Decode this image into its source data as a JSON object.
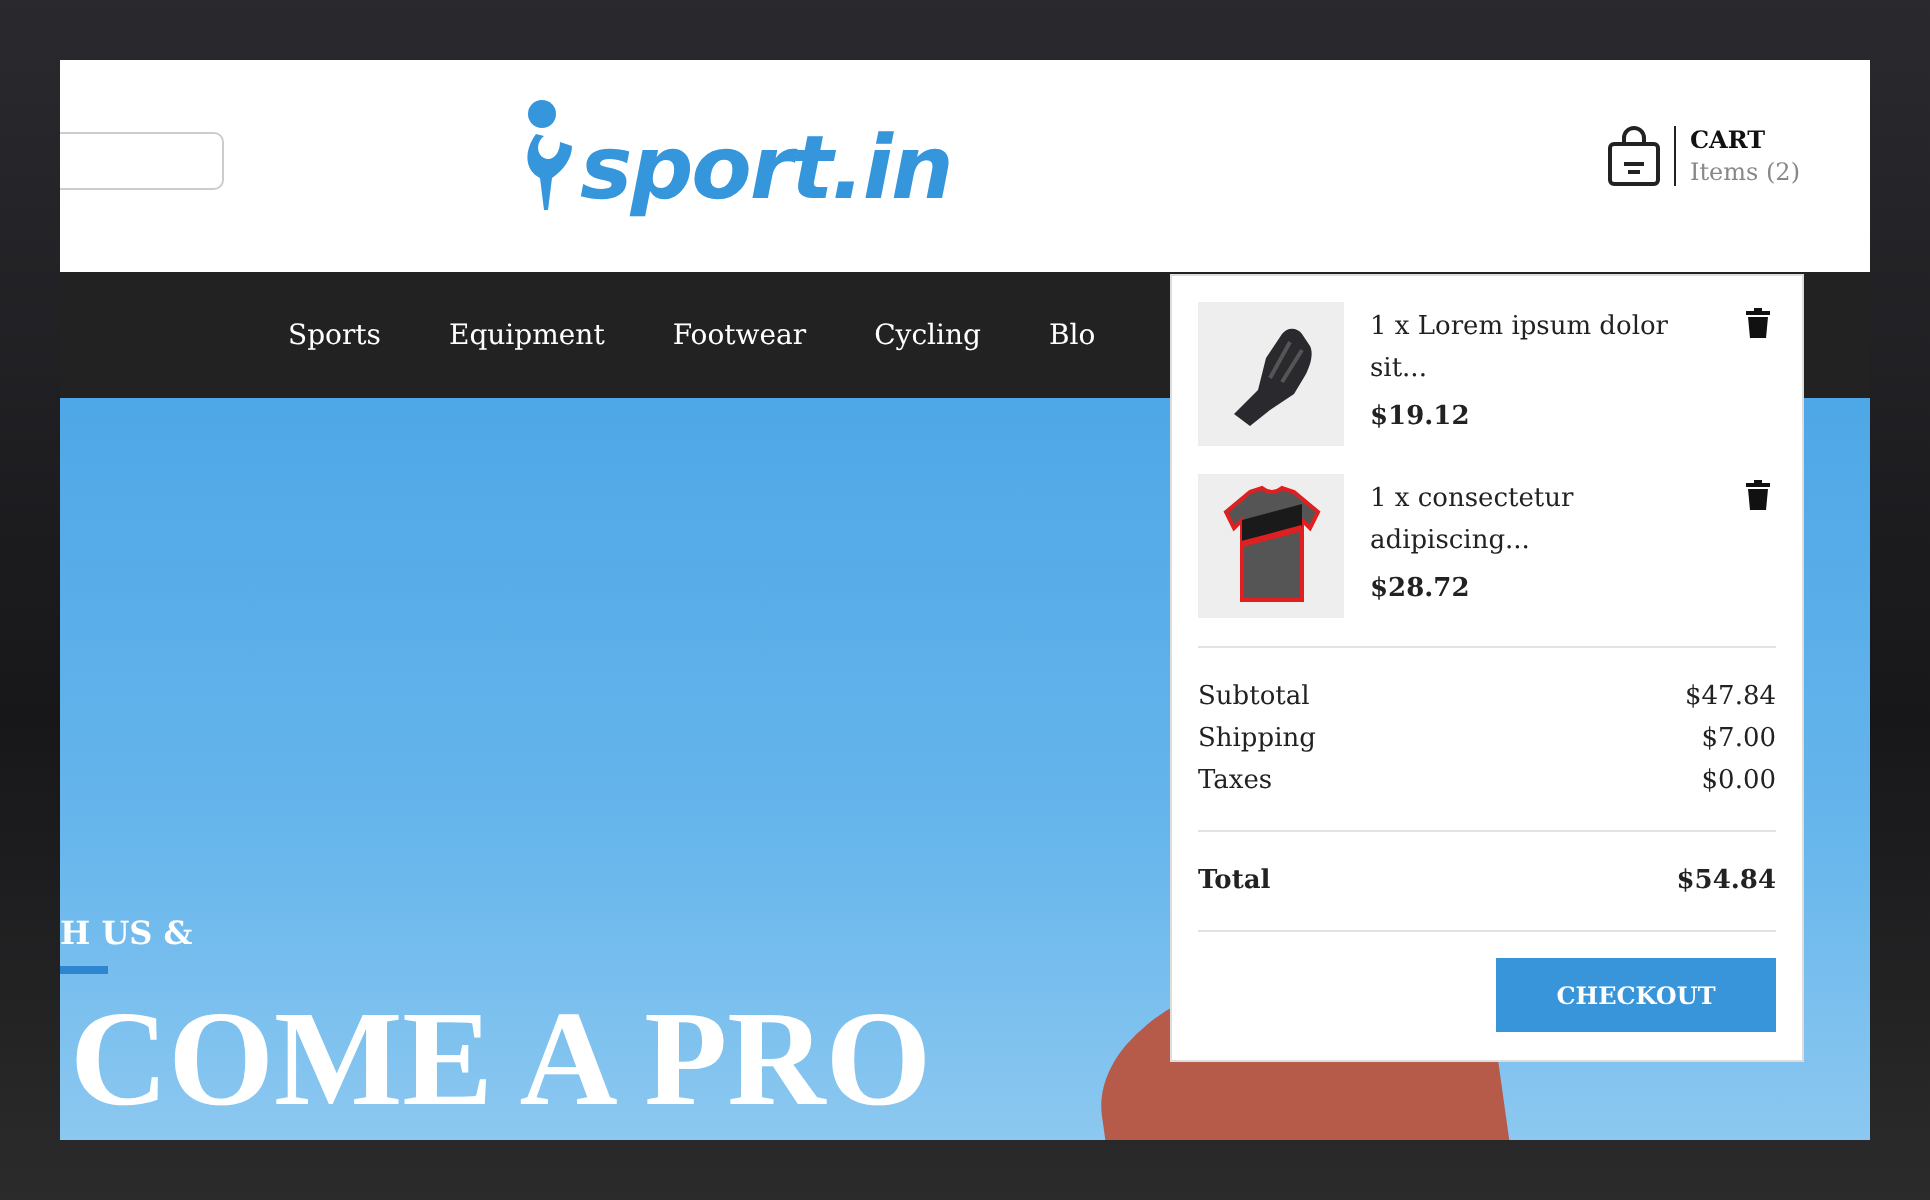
{
  "logo": {
    "text": "sport.in"
  },
  "cart": {
    "title": "CART",
    "count": "Items (2)",
    "expanded": true
  },
  "nav": {
    "items": [
      {
        "label": "Sports"
      },
      {
        "label": "Equipment"
      },
      {
        "label": "Footwear"
      },
      {
        "label": "Cycling"
      },
      {
        "label": "Blo"
      }
    ]
  },
  "hero": {
    "kicker": "H US &",
    "headline": "COME A PRO"
  },
  "cart_dropdown": {
    "items": [
      {
        "kind": "glove",
        "name": "1 x Lorem ipsum dolor sit...",
        "price": "$19.12"
      },
      {
        "kind": "jersey",
        "name": "1 x consectetur adipiscing...",
        "price": "$28.72"
      }
    ],
    "summary": [
      {
        "label": "Subtotal",
        "value": "$47.84"
      },
      {
        "label": "Shipping",
        "value": "$7.00"
      },
      {
        "label": "Taxes",
        "value": "$0.00"
      }
    ],
    "total": {
      "label": "Total",
      "value": "$54.84"
    },
    "checkout": "CHECKOUT"
  }
}
